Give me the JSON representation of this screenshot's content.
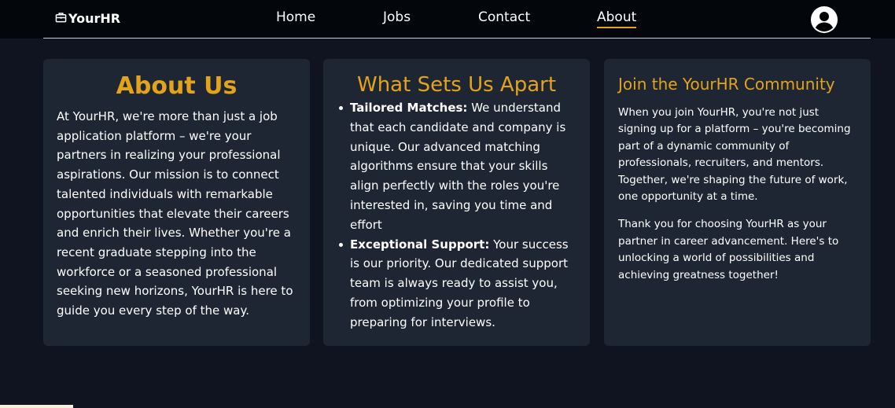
{
  "navbar": {
    "logo_text": "YourHR",
    "logo_icon": "briefcase-icon",
    "links": [
      {
        "label": "Home"
      },
      {
        "label": "Jobs"
      },
      {
        "label": "Contact"
      },
      {
        "label": "About",
        "active": true
      }
    ],
    "avatar_icon": "user-icon"
  },
  "about": {
    "title": "About Us",
    "body": "At YourHR, we're more than just a job application platform – we're your partners in realizing your professional aspirations. Our mission is to connect talented individuals with remarkable opportunities that elevate their careers and enrich their lives. Whether you're a recent graduate stepping into the workforce or a seasoned professional seeking new horizons, YourHR is here to guide you every step of the way."
  },
  "apart": {
    "title": "What Sets Us Apart",
    "items": [
      {
        "heading": "Tailored Matches:",
        "text": " We understand that each candidate and company is unique. Our advanced matching algorithms ensure that your skills align perfectly with the roles you're interested in, saving you time and effort"
      },
      {
        "heading": "Exceptional Support:",
        "text": " Your success is our priority. Our dedicated support team is always ready to assist you, from optimizing your profile to preparing for interviews."
      }
    ]
  },
  "community": {
    "title": "Join the YourHR Community",
    "paragraphs": [
      "When you join YourHR, you're not just signing up for a platform – you're becoming part of a dynamic community of professionals, recruiters, and mentors. Together, we're shaping the future of work, one opportunity at a time.",
      "Thank you for choosing YourHR as your partner in career advancement. Here's to unlocking a world of possibilities and achieving greatness together!"
    ]
  },
  "colors": {
    "background": "#0f1420",
    "navbar": "#03060b",
    "card": "#1e2633",
    "accent": "#e3a41b"
  }
}
